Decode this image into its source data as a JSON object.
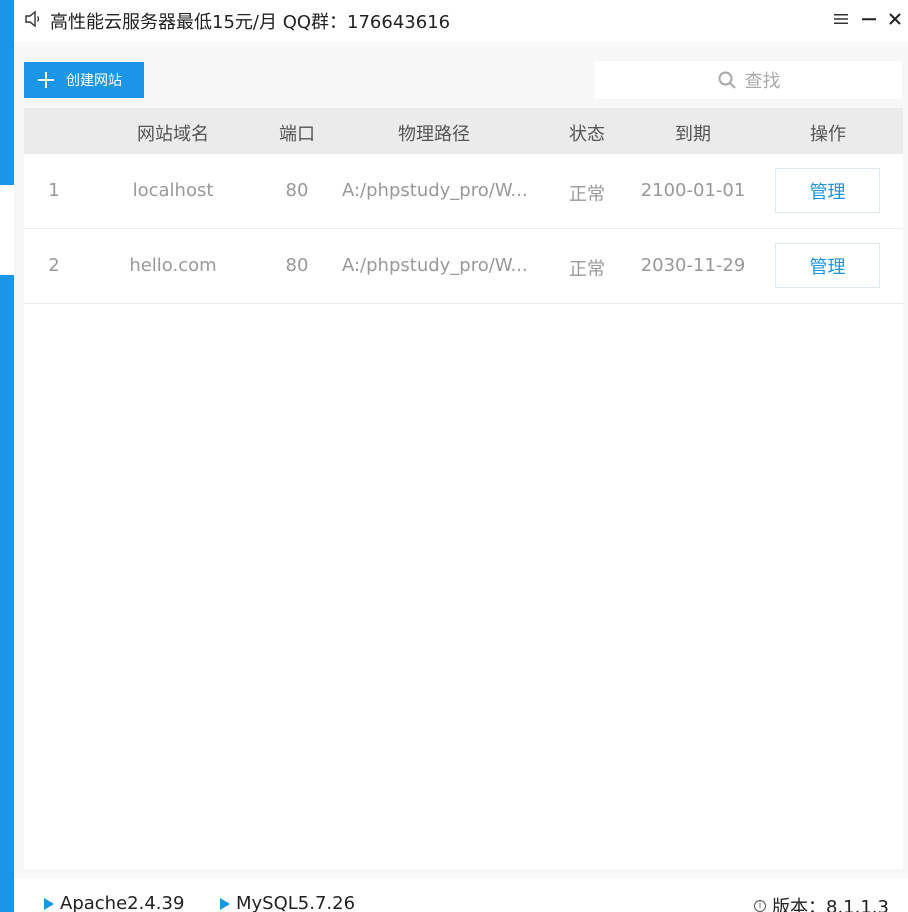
{
  "titlebar": {
    "notice": "高性能云服务器最低15元/月  QQ群：176643616"
  },
  "toolbar": {
    "create_label": "创建网站",
    "search_placeholder": "查找"
  },
  "table": {
    "headers": {
      "domain": "网站域名",
      "port": "端口",
      "path": "物理路径",
      "status": "状态",
      "expiry": "到期",
      "operation": "操作"
    },
    "rows": [
      {
        "index": "1",
        "domain": "localhost",
        "port": "80",
        "path": "A:/phpstudy_pro/W...",
        "status": "正常",
        "expiry": "2100-01-01",
        "action": "管理"
      },
      {
        "index": "2",
        "domain": "hello.com",
        "port": "80",
        "path": "A:/phpstudy_pro/W...",
        "status": "正常",
        "expiry": "2030-11-29",
        "action": "管理"
      }
    ]
  },
  "statusbar": {
    "apache": "Apache2.4.39",
    "mysql": "MySQL5.7.26",
    "version": "版本：8.1.1.3"
  },
  "icons": {
    "speaker": "speaker-icon",
    "menu": "menu-icon",
    "minimize": "minimize-icon",
    "close": "close-icon",
    "plus": "plus-icon",
    "search": "search-icon",
    "play": "play-icon",
    "info": "info-icon"
  },
  "colors": {
    "accent": "#1b95e6",
    "header_bg": "#ebebeb",
    "muted_text": "#999999"
  }
}
